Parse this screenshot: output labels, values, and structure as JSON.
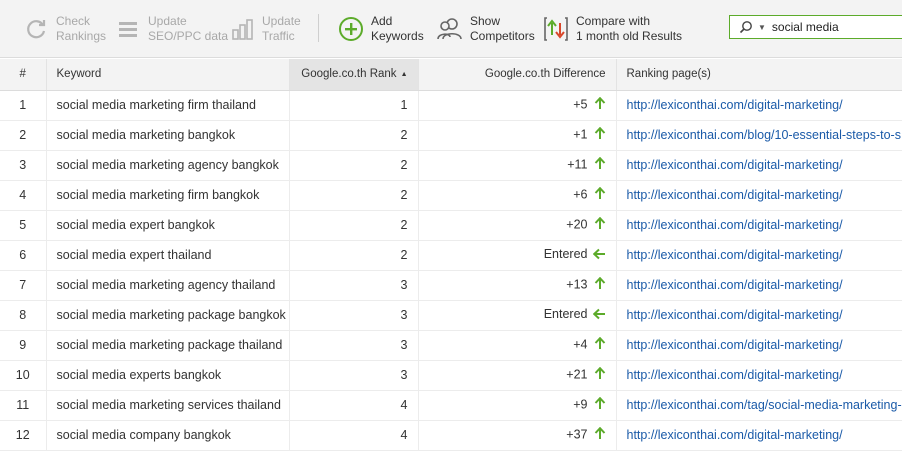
{
  "toolbar": {
    "check_rankings": "Check\nRankings",
    "update_seo": "Update\nSEO/PPC data",
    "update_traffic": "Update\nTraffic",
    "add_keywords": "Add\nKeywords",
    "show_competitors": "Show\nCompetitors",
    "compare_with": "Compare with\n1 month old Results"
  },
  "search": {
    "value": "social media"
  },
  "colors": {
    "accent_green": "#5cab2a",
    "link_blue": "#1a5aa8"
  },
  "table": {
    "headers": {
      "num": "#",
      "keyword": "Keyword",
      "rank": "Google.co.th Rank",
      "difference": "Google.co.th Difference",
      "ranking_page": "Ranking page(s)"
    },
    "rows": [
      {
        "num": "1",
        "keyword": "social media marketing firm thailand",
        "rank": "1",
        "diff": "+5",
        "trend": "up",
        "url": "http://lexiconthai.com/digital-marketing/"
      },
      {
        "num": "2",
        "keyword": "social media marketing bangkok",
        "rank": "2",
        "diff": "+1",
        "trend": "up",
        "url": "http://lexiconthai.com/blog/10-essential-steps-to-s"
      },
      {
        "num": "3",
        "keyword": "social media marketing agency bangkok",
        "rank": "2",
        "diff": "+11",
        "trend": "up",
        "url": "http://lexiconthai.com/digital-marketing/"
      },
      {
        "num": "4",
        "keyword": "social media marketing firm bangkok",
        "rank": "2",
        "diff": "+6",
        "trend": "up",
        "url": "http://lexiconthai.com/digital-marketing/"
      },
      {
        "num": "5",
        "keyword": "social media expert bangkok",
        "rank": "2",
        "diff": "+20",
        "trend": "up",
        "url": "http://lexiconthai.com/digital-marketing/"
      },
      {
        "num": "6",
        "keyword": "social media expert thailand",
        "rank": "2",
        "diff": "Entered",
        "trend": "entered",
        "url": "http://lexiconthai.com/digital-marketing/"
      },
      {
        "num": "7",
        "keyword": "social media marketing agency thailand",
        "rank": "3",
        "diff": "+13",
        "trend": "up",
        "url": "http://lexiconthai.com/digital-marketing/"
      },
      {
        "num": "8",
        "keyword": "social media marketing package bangkok",
        "rank": "3",
        "diff": "Entered",
        "trend": "entered",
        "url": "http://lexiconthai.com/digital-marketing/"
      },
      {
        "num": "9",
        "keyword": "social media marketing package thailand",
        "rank": "3",
        "diff": "+4",
        "trend": "up",
        "url": "http://lexiconthai.com/digital-marketing/"
      },
      {
        "num": "10",
        "keyword": "social media experts bangkok",
        "rank": "3",
        "diff": "+21",
        "trend": "up",
        "url": "http://lexiconthai.com/digital-marketing/"
      },
      {
        "num": "11",
        "keyword": "social media marketing services thailand",
        "rank": "4",
        "diff": "+9",
        "trend": "up",
        "url": "http://lexiconthai.com/tag/social-media-marketing-"
      },
      {
        "num": "12",
        "keyword": "social media company bangkok",
        "rank": "4",
        "diff": "+37",
        "trend": "up",
        "url": "http://lexiconthai.com/digital-marketing/"
      }
    ]
  }
}
